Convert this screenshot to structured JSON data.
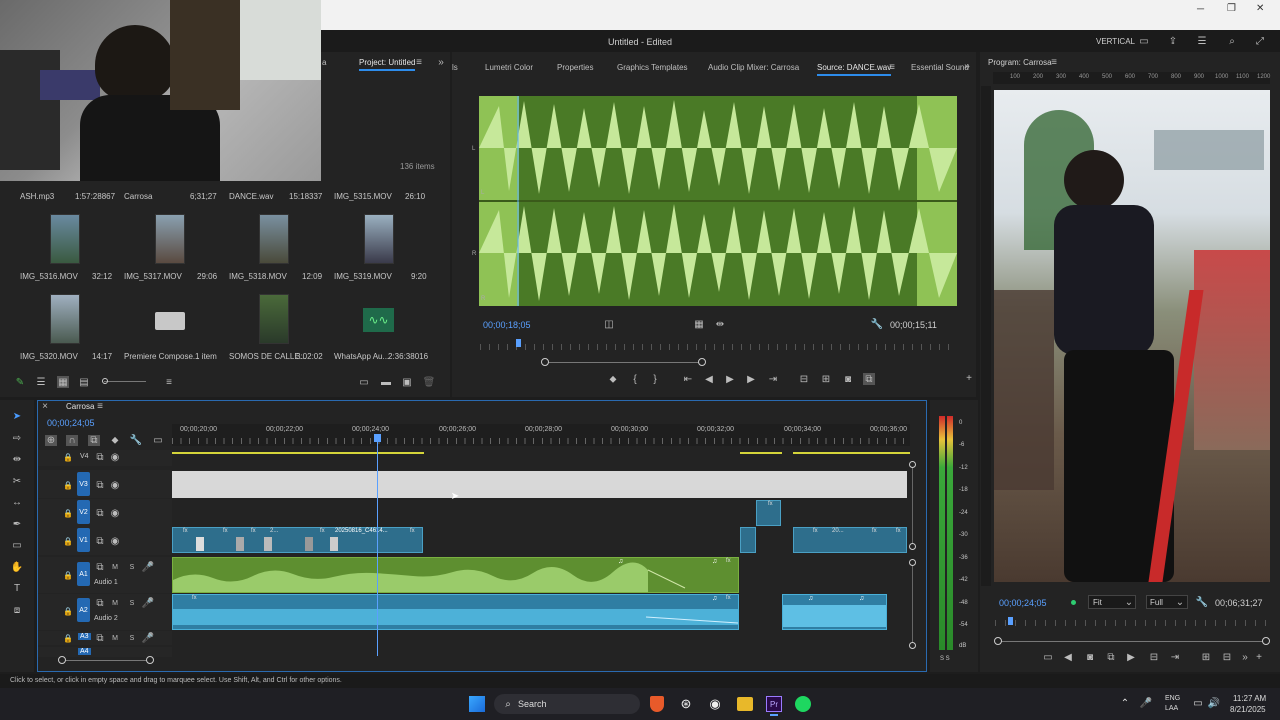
{
  "window": {
    "title": "Untitled - Edited",
    "workspace": "VERTICAL",
    "min": "─",
    "max": "❐",
    "close": "✕"
  },
  "project": {
    "tab_partial": "a",
    "tab": "Project: Untitled",
    "items_count": "136 items",
    "top_row": [
      {
        "name": "ASH.mp3",
        "dur": "1:57:28867"
      },
      {
        "name": "Carrosa",
        "dur": "6;31;27"
      },
      {
        "name": "DANCE.wav",
        "dur": "15:18337"
      },
      {
        "name": "IMG_5315.MOV",
        "dur": "26:10"
      }
    ],
    "row2": [
      {
        "name": "IMG_5316.MOV",
        "dur": "32:12"
      },
      {
        "name": "IMG_5317.MOV",
        "dur": "29:06"
      },
      {
        "name": "IMG_5318.MOV",
        "dur": "12:09"
      },
      {
        "name": "IMG_5319.MOV",
        "dur": "9:20"
      }
    ],
    "row3": [
      {
        "name": "IMG_5320.MOV",
        "dur": "14:17"
      },
      {
        "name": "Premiere Compose...",
        "dur": "1 item"
      },
      {
        "name": "SOMOS DE CALLE...",
        "dur": "3:02:02"
      },
      {
        "name": "WhatsApp Au...",
        "dur": "2:36:38016"
      }
    ]
  },
  "source": {
    "tabs": [
      "ls",
      "Lumetri Color",
      "Properties",
      "Graphics Templates",
      "Audio Clip Mixer: Carrosa",
      "Source: DANCE.wav",
      "Essential Sound"
    ],
    "timecode_left": "00;00;18;05",
    "timecode_right": "00;00;15;11",
    "channel_labels": [
      "L",
      "L",
      "R",
      "R"
    ]
  },
  "program": {
    "tab": "Program: Carrosa",
    "ruler": [
      "100",
      "200",
      "300",
      "400",
      "500",
      "600",
      "700",
      "800",
      "900",
      "1000",
      "1100",
      "1200"
    ],
    "timecode_left": "00;00;24;05",
    "fit": "Fit",
    "full": "Full",
    "timecode_right": "00;06;31;27"
  },
  "timeline": {
    "tab": "Carrosa",
    "timecode": "00;00;24;05",
    "ruler": [
      "00;00;20;00",
      "00;00;22;00",
      "00;00;24;00",
      "00;00;26;00",
      "00;00;28;00",
      "00;00;30;00",
      "00;00;32;00",
      "00;00;34;00",
      "00;00;36;00"
    ],
    "tracks": [
      {
        "id": "V4"
      },
      {
        "id": "V3"
      },
      {
        "id": "V2"
      },
      {
        "id": "V1"
      },
      {
        "id": "A1",
        "name": "Audio 1"
      },
      {
        "id": "A2",
        "name": "Audio 2"
      },
      {
        "id": "A3"
      },
      {
        "id": "A4"
      }
    ],
    "clip_label": "20250816_C4614...",
    "clip_short1": "2...",
    "clip_short2": "20...",
    "fx": "fx"
  },
  "meter": {
    "scale": [
      "0",
      "-6",
      "-12",
      "-18",
      "-24",
      "-30",
      "-36",
      "-42",
      "-48",
      "-54",
      "dB"
    ],
    "solo": "S S"
  },
  "status": {
    "text": "Click to select, or click in empty space and drag to marquee select. Use Shift, Alt, and Ctrl for other options."
  },
  "taskbar": {
    "search": "Search",
    "lang1": "ENG",
    "lang2": "LAA",
    "time": "11:27 AM",
    "date": "8/21/2025"
  },
  "colors": {
    "accent": "#2d8ceb",
    "timecode": "#5aa0ff",
    "video_clip": "#2e6e8c",
    "audio_green": "#6ea43a",
    "audio_blue": "#4ab0d8"
  }
}
